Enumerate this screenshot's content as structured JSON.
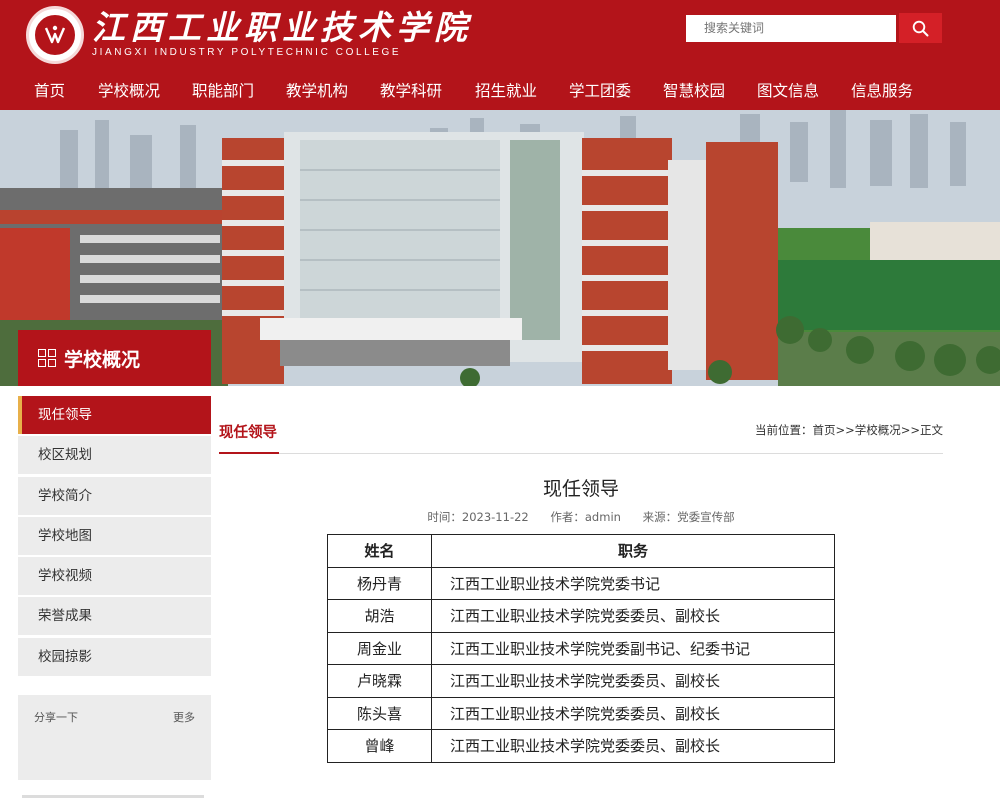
{
  "header": {
    "logo_cn": "江西工业职业技术学院",
    "logo_en": "JIANGXI INDUSTRY POLYTECHNIC COLLEGE",
    "search_placeholder": "搜索关键词"
  },
  "nav": {
    "items": [
      {
        "label": "首页"
      },
      {
        "label": "学校概况"
      },
      {
        "label": "职能部门"
      },
      {
        "label": "教学机构"
      },
      {
        "label": "教学科研"
      },
      {
        "label": "招生就业"
      },
      {
        "label": "学工团委"
      },
      {
        "label": "智慧校园"
      },
      {
        "label": "图文信息"
      },
      {
        "label": "信息服务"
      }
    ]
  },
  "section": {
    "title": "学校概况"
  },
  "sidebar": {
    "items": [
      {
        "label": "现任领导",
        "active": true
      },
      {
        "label": "校区规划"
      },
      {
        "label": "学校简介"
      },
      {
        "label": "学校地图"
      },
      {
        "label": "学校视频"
      },
      {
        "label": "荣誉成果"
      },
      {
        "label": "校园掠影"
      }
    ],
    "share_label": "分享一下",
    "more_label": "更多"
  },
  "content": {
    "tab_label": "现任领导",
    "breadcrumb": "当前位置：首页>>学校概况>>正文",
    "article_title": "现任领导",
    "meta_time": "时间：2023-11-22",
    "meta_author": "作者：admin",
    "meta_source": "来源：党委宣传部",
    "table": {
      "headers": [
        "姓名",
        "职务"
      ],
      "rows": [
        {
          "name": "杨丹青",
          "post": "江西工业职业技术学院党委书记"
        },
        {
          "name": "胡浩",
          "post": "江西工业职业技术学院党委委员、副校长"
        },
        {
          "name": "周金业",
          "post": "江西工业职业技术学院党委副书记、纪委书记"
        },
        {
          "name": "卢晓霖",
          "post": "江西工业职业技术学院党委委员、副校长"
        },
        {
          "name": "陈头喜",
          "post": "江西工业职业技术学院党委委员、副校长"
        },
        {
          "name": "曾峰",
          "post": "江西工业职业技术学院党委委员、副校长"
        }
      ]
    }
  },
  "colors": {
    "brand_red": "#b3141a",
    "search_red": "#d42027",
    "active_accent": "#e8b04a"
  },
  "icons": {
    "search": "search-icon",
    "section": "grid-icon",
    "logo": "logo-seal-icon"
  }
}
